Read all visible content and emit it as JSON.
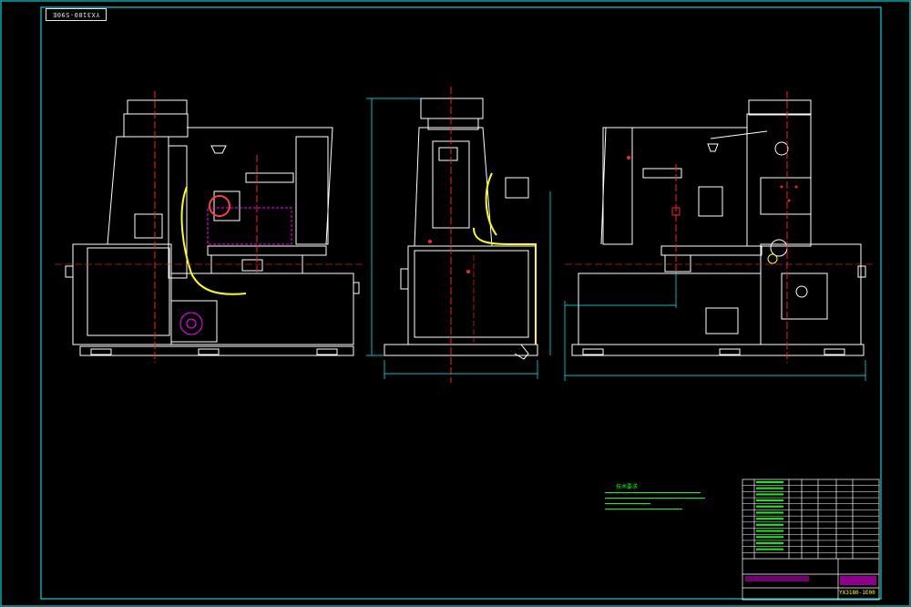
{
  "drawing": {
    "number_stamp": "YX3180-S90E",
    "title_block_number": "YX3180-1E00",
    "colors": {
      "background": "#000000",
      "frame": "#00ffff",
      "outline": "#ffffff",
      "dimension": "#00ffff",
      "center_line": "#ff2020",
      "hidden_line": "#ff00ff",
      "hose": "#ffff00",
      "notes": "#00ff00"
    }
  },
  "views": [
    {
      "name": "front-elevation"
    },
    {
      "name": "side-elevation"
    },
    {
      "name": "rear-elevation"
    }
  ],
  "notes": {
    "heading": "技术要求",
    "lines": [
      "",
      "",
      "",
      ""
    ]
  },
  "parts_list": {
    "row_count": 13
  }
}
